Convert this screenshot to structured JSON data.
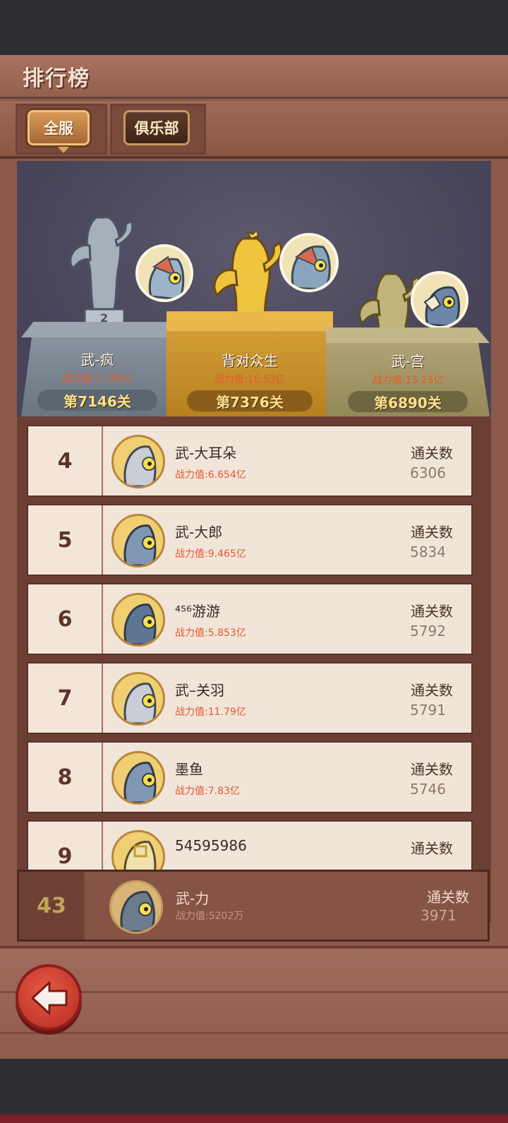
{
  "header": {
    "title": "排行榜"
  },
  "tabs": [
    {
      "label": "全服",
      "selected": true
    },
    {
      "label": "俱乐部",
      "selected": false
    }
  ],
  "podium": [
    {
      "place": 2,
      "name": "武-疯",
      "power": "战力值:7.746亿",
      "level": "第7146关",
      "color": "#8c97a3"
    },
    {
      "place": 1,
      "name": "背对众生",
      "power": "战力值:16.53亿",
      "level": "第7376关",
      "color": "#d6a23a"
    },
    {
      "place": 3,
      "name": "武-宫",
      "power": "战力值:13.25亿",
      "level": "第6890关",
      "color": "#b5a77a"
    }
  ],
  "list": [
    {
      "rank": "4",
      "name": "武-大耳朵",
      "power": "战力值:6.654亿",
      "count_label": "通关数",
      "count": "6306"
    },
    {
      "rank": "5",
      "name": "武-大郎",
      "power": "战力值:9.465亿",
      "count_label": "通关数",
      "count": "5834"
    },
    {
      "rank": "6",
      "name": "⁴⁵⁶游游",
      "power": "战力值:5.853亿",
      "count_label": "通关数",
      "count": "5792"
    },
    {
      "rank": "7",
      "name": "武–关羽",
      "power": "战力值:11.79亿",
      "count_label": "通关数",
      "count": "5791"
    },
    {
      "rank": "8",
      "name": "墨鱼",
      "power": "战力值:7.83亿",
      "count_label": "通关数",
      "count": "5746"
    },
    {
      "rank": "9",
      "name": "54595986",
      "power": "",
      "count_label": "通关数",
      "count": ""
    }
  ],
  "me": {
    "rank": "43",
    "name": "武-力",
    "power": "战力值:5202万",
    "count_label": "通关数",
    "count": "3971"
  },
  "icons": {
    "back": "back-arrow-icon"
  }
}
